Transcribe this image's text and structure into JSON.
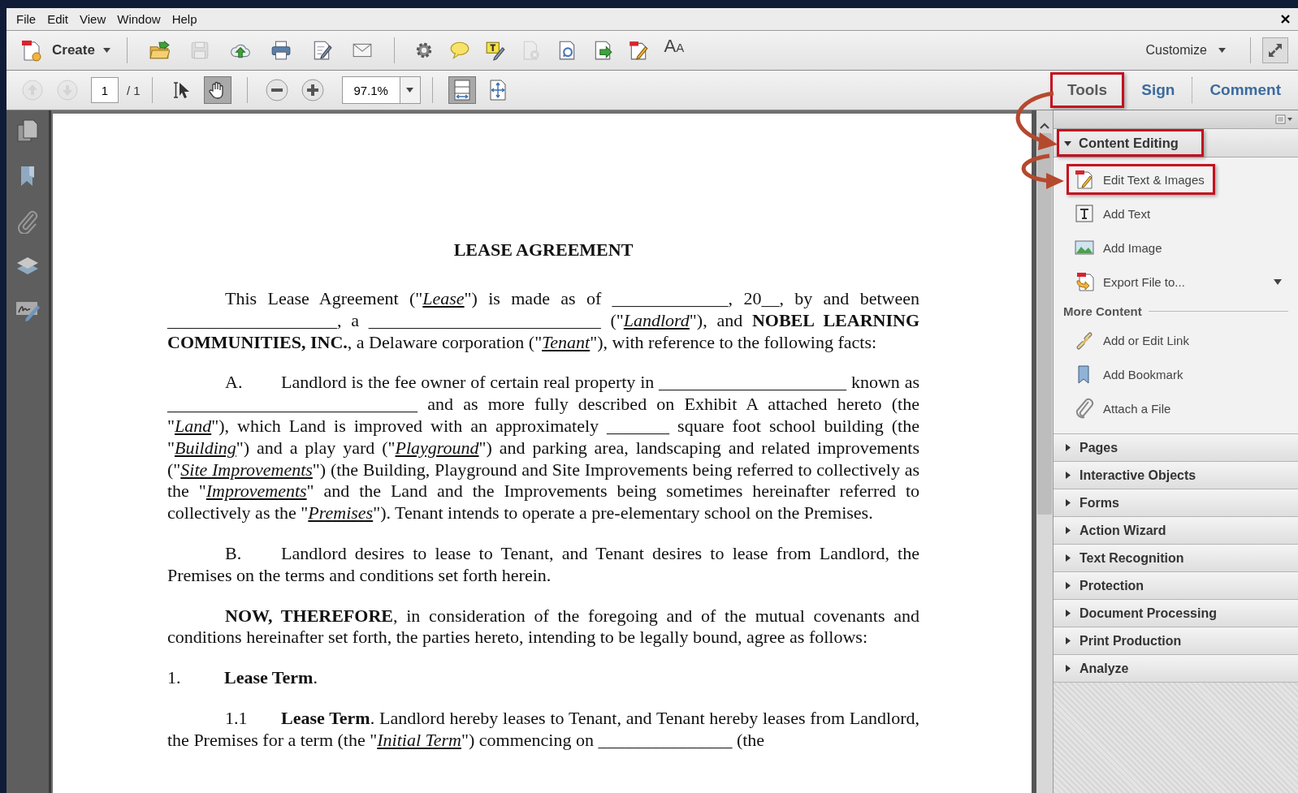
{
  "menu": [
    "File",
    "Edit",
    "View",
    "Window",
    "Help"
  ],
  "toolbar": {
    "create_label": "Create",
    "tools": [
      {
        "disabled": false
      },
      {
        "disabled": true
      },
      {
        "disabled": false
      },
      {
        "disabled": false
      },
      {
        "disabled": false
      },
      {
        "disabled": false
      },
      {
        "disabled": false
      },
      {
        "disabled": false
      },
      {
        "disabled": false
      },
      {
        "disabled": true
      },
      {
        "disabled": false
      },
      {
        "disabled": false
      },
      {
        "disabled": false
      }
    ],
    "text_tool": {
      "large": "A",
      "small": "A"
    },
    "customize_label": "Customize"
  },
  "navigation": {
    "arrows": [
      {
        "disabled": true
      },
      {
        "disabled": true
      }
    ],
    "page": "1",
    "total": "/ 1",
    "pointer_tools": [
      {
        "pressed": false
      },
      {
        "pressed": true
      }
    ],
    "zoom": "97.1%",
    "fit_tools": [
      {
        "pressed": true
      },
      {
        "pressed": false
      }
    ]
  },
  "tabs": [
    {
      "label": "Tools",
      "selected": true,
      "annotated": true
    },
    {
      "label": "Sign",
      "selected": false,
      "annotated": false
    },
    {
      "label": "Comment",
      "selected": false,
      "annotated": false
    }
  ],
  "document": {
    "title": "LEASE AGREEMENT",
    "paragraphs": [
      {
        "kind": "body",
        "text": "This Lease Agreement (\"*Lease*\") is made as of _____________, 20__, by and between ___________________, a __________________________ (\"*Landlord*\"), and **NOBEL LEARNING COMMUNITIES, INC.**, a Delaware corporation (\"*Tenant*\"), with reference to the following facts:"
      },
      {
        "kind": "lettered",
        "label": "A.",
        "text": "Landlord is the fee owner of certain real property in _____________________ known as ____________________________ and as more fully described on Exhibit A attached hereto (the \"*Land*\"), which Land is improved with an approximately _______ square foot school building (the \"*Building*\") and a play yard (\"*Playground*\") and parking area, landscaping and related improvements (\"*Site Improvements*\") (the Building, Playground and Site Improvements being referred to collectively as the \"*Improvements*\" and the Land and the Improvements being sometimes hereinafter referred to collectively as the \"*Premises*\").  Tenant intends to operate a pre-elementary school on the Premises."
      },
      {
        "kind": "lettered",
        "label": "B.",
        "text": "Landlord desires to lease to Tenant, and Tenant desires to lease from Landlord, the Premises on the terms and conditions set forth herein."
      },
      {
        "kind": "body",
        "text": "**NOW, THEREFORE**, in consideration of the foregoing and of the mutual covenants and conditions hereinafter set forth, the parties hereto, intending to be legally bound, agree as follows:"
      },
      {
        "kind": "section",
        "label": "1.",
        "text": "**Lease Term**."
      },
      {
        "kind": "lettered",
        "label": "1.1",
        "text": "**Lease Term**. Landlord hereby leases to Tenant, and Tenant hereby leases from Landlord, the Premises for a term (the \"*Initial Term*\") commencing on _______________ (the"
      }
    ]
  },
  "panel": {
    "group": {
      "title": "Content Editing",
      "expanded": true,
      "annotated": true,
      "items": [
        {
          "label": "Edit Text & Images",
          "annotated": true,
          "has_menu": false
        },
        {
          "label": "Add Text",
          "annotated": false,
          "has_menu": false
        },
        {
          "label": "Add Image",
          "annotated": false,
          "has_menu": false
        },
        {
          "label": "Export File to...",
          "annotated": false,
          "has_menu": true
        }
      ],
      "more_label": "More Content",
      "more_items": [
        {
          "label": "Add or Edit Link"
        },
        {
          "label": "Add Bookmark"
        },
        {
          "label": "Attach a File"
        }
      ]
    },
    "sections": [
      {
        "title": "Pages",
        "expanded": false
      },
      {
        "title": "Interactive Objects",
        "expanded": false
      },
      {
        "title": "Forms",
        "expanded": false
      },
      {
        "title": "Action Wizard",
        "expanded": false
      },
      {
        "title": "Text Recognition",
        "expanded": false
      },
      {
        "title": "Protection",
        "expanded": false
      },
      {
        "title": "Document Processing",
        "expanded": false
      },
      {
        "title": "Print Production",
        "expanded": false
      },
      {
        "title": "Analyze",
        "expanded": false
      }
    ]
  }
}
